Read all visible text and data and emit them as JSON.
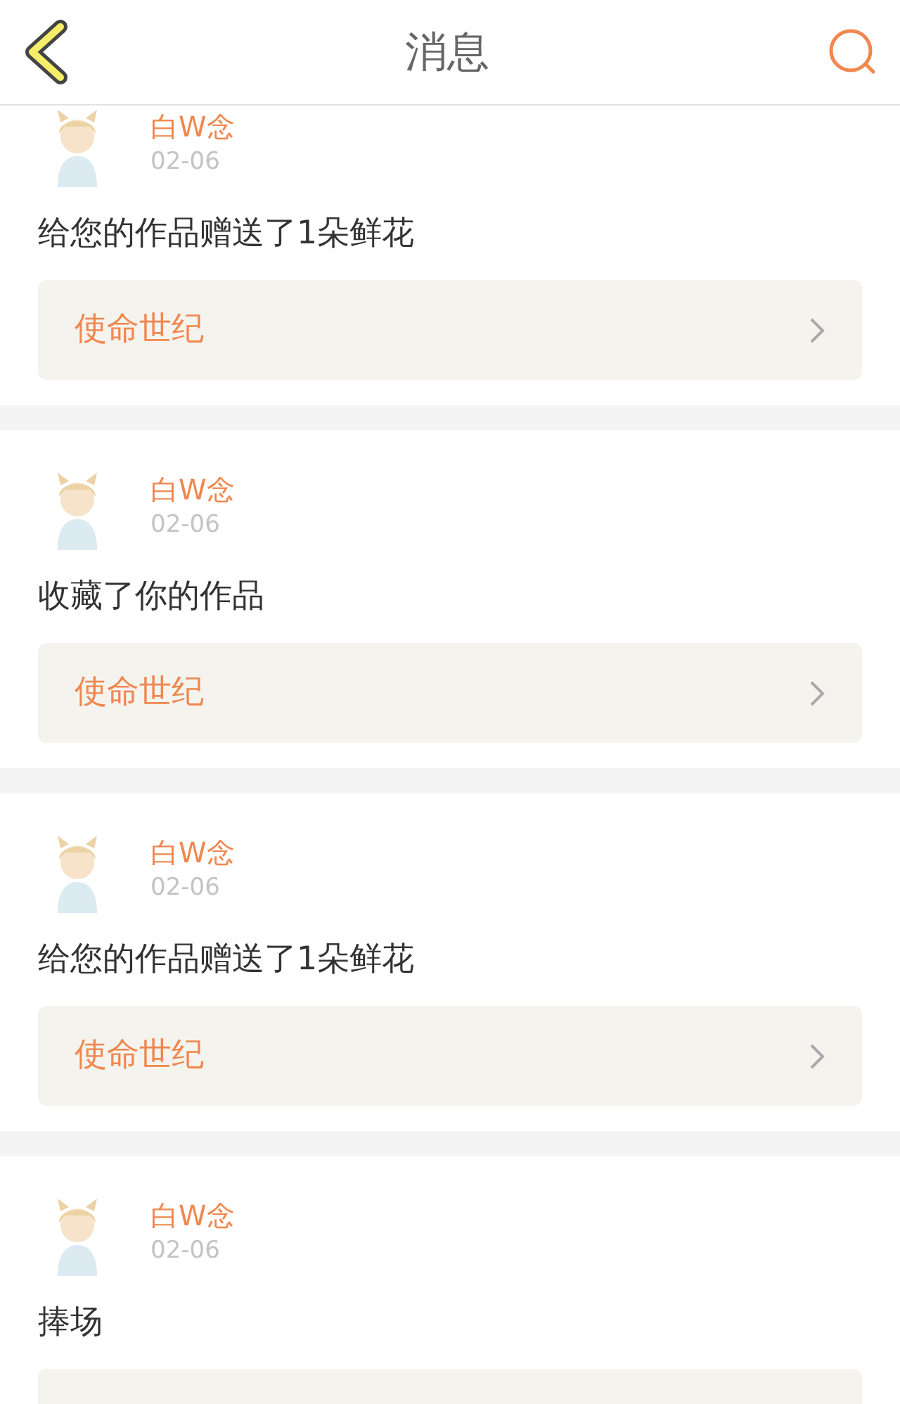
{
  "header": {
    "title": "消息"
  },
  "messages": [
    {
      "user": "白W念",
      "date": "02-06",
      "text": "给您的作品赠送了1朵鲜花",
      "work_panel": true,
      "work": "使命世纪"
    },
    {
      "user": "白W念",
      "date": "02-06",
      "text": "收藏了你的作品",
      "work_panel": true,
      "work": "使命世纪"
    },
    {
      "user": "白W念",
      "date": "02-06",
      "text": "给您的作品赠送了1朵鲜花",
      "work_panel": true,
      "work": "使命世纪"
    },
    {
      "user": "白W念",
      "date": "02-06",
      "text": "捧场",
      "work_panel": true
    }
  ]
}
